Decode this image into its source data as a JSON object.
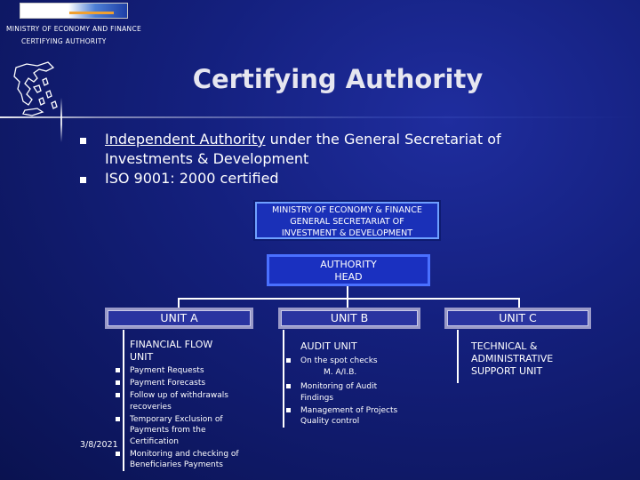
{
  "header": {
    "line1": "MINISTRY OF ECONOMY AND FINANCE",
    "line2": "CERTIFYING AUTHORITY"
  },
  "title": "Certifying Authority",
  "bullets": [
    {
      "prefix": "Independent Authority",
      "rest_line1": " under the General Secretariat of",
      "line2": "Investments & Development"
    },
    {
      "text": "ISO 9001: 2000 certified"
    }
  ],
  "org": {
    "ministry_box": [
      "MINISTRY OF ECONOMY & FINANCE",
      "GENERAL SECRETARIAT OF",
      "INVESTMENT & DEVELOPMENT"
    ],
    "head_box": [
      "AUTHORITY",
      "HEAD"
    ],
    "units": [
      {
        "label": "UNIT A",
        "title": [
          "FINANCIAL FLOW",
          "UNIT"
        ],
        "items": [
          [
            "Payment Requests"
          ],
          [
            "Payment Forecasts"
          ],
          [
            "Follow up of withdrawals",
            "recoveries"
          ],
          [
            "Temporary Exclusion of",
            "Payments from the",
            "Certification"
          ],
          [
            "Monitoring and checking of",
            "Beneficiaries Payments"
          ]
        ]
      },
      {
        "label": "UNIT B",
        "title": [
          "AUDIT UNIT"
        ],
        "items": [
          [
            "On the spot checks",
            "M. A/I.B."
          ],
          [
            "Monitoring of Audit",
            "Findings"
          ],
          [
            "Management of Projects",
            "Quality control"
          ]
        ]
      },
      {
        "label": "UNIT C",
        "title": [
          "TECHNICAL &",
          "ADMINISTRATIVE",
          "SUPPORT UNIT"
        ]
      }
    ]
  },
  "date": "3/8/2021"
}
